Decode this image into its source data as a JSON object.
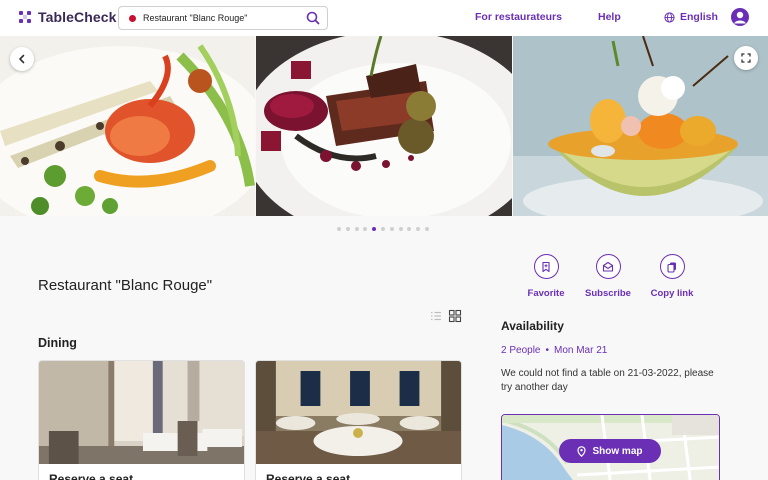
{
  "header": {
    "brand": "TableCheck",
    "search_value": "Restaurant \"Blanc Rouge\"",
    "for_restaurateurs": "For restaurateurs",
    "help": "Help",
    "language": "English"
  },
  "carousel": {
    "slide_count": 11,
    "active_index": 4
  },
  "restaurant": {
    "name": "Restaurant \"Blanc Rouge\""
  },
  "actions": {
    "favorite": "Favorite",
    "subscribe": "Subscribe",
    "copy_link": "Copy link"
  },
  "dining": {
    "section_title": "Dining",
    "cards": [
      {
        "label": "Reserve a seat"
      },
      {
        "label": "Reserve a seat"
      }
    ]
  },
  "availability": {
    "title": "Availability",
    "people": "2 People",
    "separator": "•",
    "date": "Mon Mar 21",
    "message": "We could not find a table on 21-03-2022, please try another day"
  },
  "map": {
    "show_map": "Show map"
  },
  "colors": {
    "accent": "#6a2fb5",
    "brand_text": "#3a2a55",
    "flag_red": "#c8102e"
  },
  "icons": [
    "tablecheck-logo-icon",
    "japan-flag-icon",
    "search-icon",
    "globe-icon",
    "user-icon",
    "chevron-left-icon",
    "expand-icon",
    "bookmark-icon",
    "mail-icon",
    "copy-icon",
    "list-view-icon",
    "grid-view-icon",
    "map-pin-icon"
  ]
}
